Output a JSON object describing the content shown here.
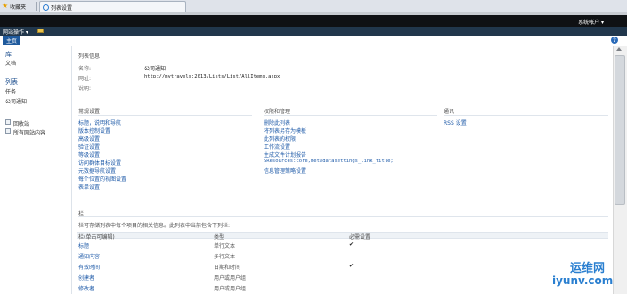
{
  "browser": {
    "favorites_label": "收藏夹",
    "tab_title": "列表设置"
  },
  "topbar": {
    "user_label": "系统帐户 ▾"
  },
  "actions": {
    "site_actions_label": "网站操作 ▾"
  },
  "tabs": {
    "home_label": "主页"
  },
  "leftnav": {
    "libraries_header": "库",
    "libraries": [
      "文档"
    ],
    "lists_header": "列表",
    "lists": [
      "任务",
      "公司通知"
    ],
    "recycle_bin": "回收站",
    "all_site_content": "所有网站内容"
  },
  "list_info": {
    "title": "列表信息",
    "name_label": "名称:",
    "name_value": "公司通知",
    "web_label": "网址:",
    "web_value": "http://mytravels:2013/Lists/List/AllItems.aspx",
    "desc_label": "说明:"
  },
  "general_settings": {
    "title": "常规设置",
    "links": [
      "标题，说明和导航",
      "版本控制设置",
      "高级设置",
      "验证设置",
      "等级设置",
      "访问群体目标设置",
      "元数据导航设置",
      "每个位置的视图设置",
      "表单设置"
    ]
  },
  "permissions": {
    "title": "权限和管理",
    "links": [
      "删除此列表",
      "将列表另存为模板",
      "此列表的权限",
      "工作流设置",
      "生成文件计划报告",
      "$Resources:core,metadatasettings_link_title;",
      "信息管理策略设置"
    ]
  },
  "communications": {
    "title": "通讯",
    "links": [
      "RSS 设置"
    ]
  },
  "columns": {
    "title": "栏",
    "description": "栏可存储列表中每个项目的相关信息。此列表中当前包含下列栏:",
    "headers": [
      "栏(单击可编辑)",
      "类型",
      "必需设置"
    ],
    "rows": [
      {
        "name": "标题",
        "type": "单行文本",
        "required": "✔"
      },
      {
        "name": "通知内容",
        "type": "多行文本",
        "required": ""
      },
      {
        "name": "有效时间",
        "type": "日期和时间",
        "required": "✔"
      },
      {
        "name": "创建者",
        "type": "用户或用户组",
        "required": ""
      },
      {
        "name": "修改者",
        "type": "用户或用户组",
        "required": ""
      }
    ]
  },
  "watermark": {
    "cn": "运维网",
    "url": "iyunv.com"
  }
}
